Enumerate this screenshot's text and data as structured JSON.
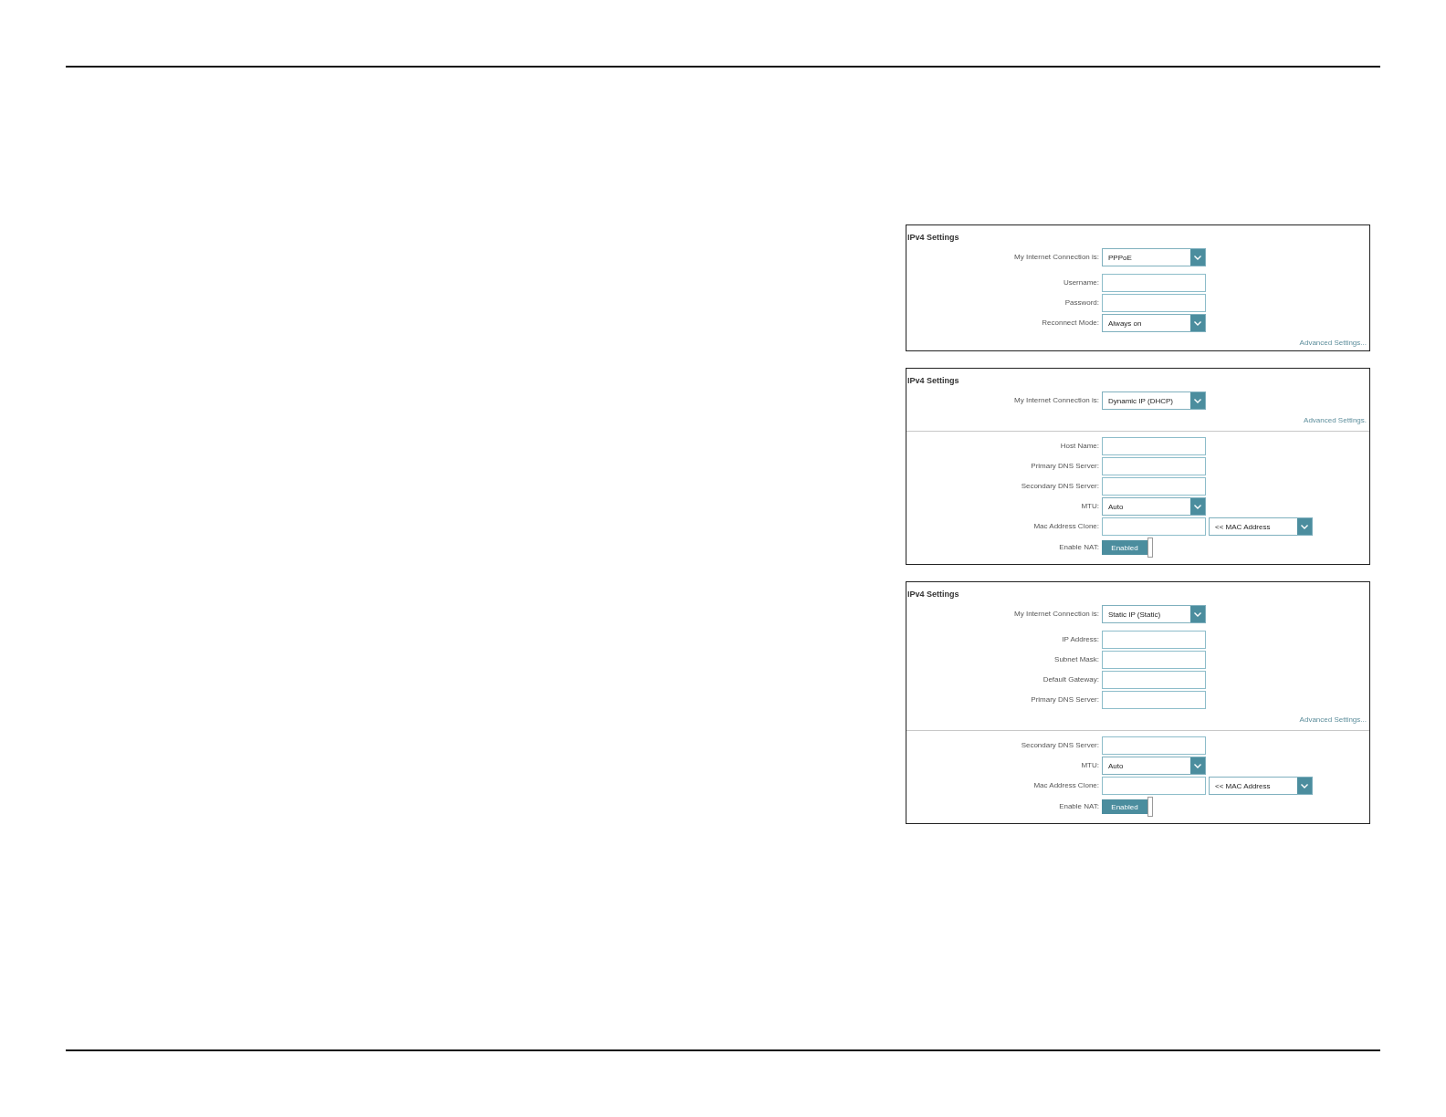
{
  "panels": [
    {
      "title": "IPv4 Settings",
      "connection": {
        "label": "My Internet Connection is:",
        "value": "PPPoE"
      },
      "sections": [
        {
          "rows": [
            {
              "kind": "input",
              "label": "Username:"
            },
            {
              "kind": "input",
              "label": "Password:"
            },
            {
              "kind": "select",
              "label": "Reconnect Mode:",
              "value": "Always on"
            },
            {
              "kind": "link",
              "text": "Advanced Settings..."
            }
          ]
        }
      ]
    },
    {
      "title": "IPv4 Settings",
      "connection": {
        "label": "My Internet Connection is:",
        "value": "Dynamic IP (DHCP)"
      },
      "sections": [
        {
          "rows": [
            {
              "kind": "link",
              "text": "Advanced Settings."
            }
          ]
        },
        {
          "rows": [
            {
              "kind": "input",
              "label": "Host Name:"
            },
            {
              "kind": "input",
              "label": "Primary DNS Server:"
            },
            {
              "kind": "input",
              "label": "Secondary DNS Server:"
            },
            {
              "kind": "select",
              "label": "MTU:",
              "value": "Auto"
            },
            {
              "kind": "mac",
              "label": "Mac Address Clone:",
              "value": "<< MAC Address"
            },
            {
              "kind": "toggle",
              "label": "Enable NAT:",
              "text": "Enabled",
              "on": true
            }
          ]
        }
      ]
    },
    {
      "title": "IPv4 Settings",
      "connection": {
        "label": "My Internet Connection is:",
        "value": "Static IP (Static)"
      },
      "sections": [
        {
          "rows": [
            {
              "kind": "input",
              "label": "IP Address:"
            },
            {
              "kind": "input",
              "label": "Subnet Mask:"
            },
            {
              "kind": "input",
              "label": "Default Gateway:"
            },
            {
              "kind": "input",
              "label": "Primary DNS Server:"
            },
            {
              "kind": "link",
              "text": "Advanced Settings..."
            }
          ]
        },
        {
          "rows": [
            {
              "kind": "input",
              "label": "Secondary DNS Server:"
            },
            {
              "kind": "select",
              "label": "MTU:",
              "value": "Auto"
            },
            {
              "kind": "mac",
              "label": "Mac Address Clone:",
              "value": "<< MAC Address"
            },
            {
              "kind": "toggle",
              "label": "Enable NAT:",
              "text": "Enabled",
              "on": true
            }
          ]
        }
      ]
    }
  ]
}
